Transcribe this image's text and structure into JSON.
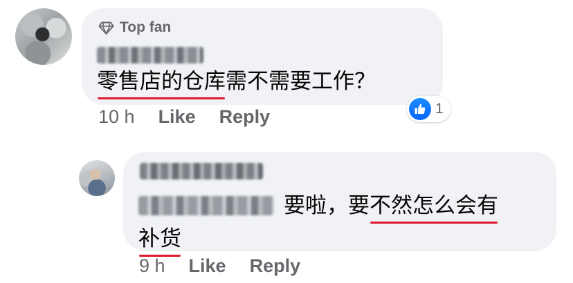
{
  "comments": [
    {
      "badge": "Top fan",
      "text_plain_before": "",
      "text_underlined": "零售店的仓库",
      "text_plain_after": "需不需要工作？",
      "time": "10 h",
      "like_label": "Like",
      "reply_label": "Reply",
      "reaction_count": "1"
    },
    {
      "text_plain_before": "要啦，要",
      "text_underlined_1": "不然怎么会有",
      "text_underlined_2": "补货",
      "time": "9 h",
      "like_label": "Like",
      "reply_label": "Reply"
    }
  ],
  "icons": {
    "badge_icon": "diamond-icon",
    "reaction_icon": "thumbs-up-icon"
  },
  "colors": {
    "bubble": "#f0f2f5",
    "meta_text": "#65676b",
    "like_blue": "#0866ff",
    "annotation_red": "#e0182d"
  }
}
